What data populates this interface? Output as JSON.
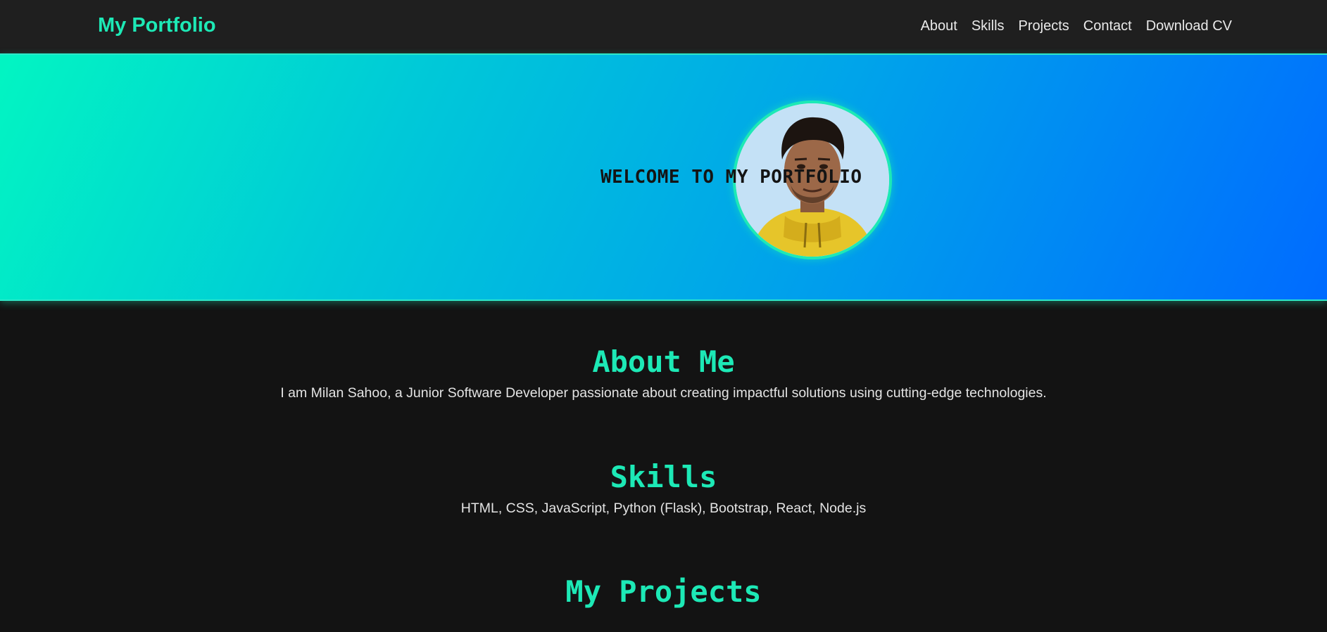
{
  "navbar": {
    "brand": "My Portfolio",
    "links": [
      {
        "label": "About"
      },
      {
        "label": "Skills"
      },
      {
        "label": "Projects"
      },
      {
        "label": "Contact"
      },
      {
        "label": "Download CV"
      }
    ]
  },
  "hero": {
    "title": "WELCOME TO MY PORTFOLIO",
    "image_alt": "profile-photo"
  },
  "about": {
    "heading": "About Me",
    "text": "I am Milan Sahoo, a Junior Software Developer passionate about creating impactful solutions using cutting-edge technologies."
  },
  "skills": {
    "heading": "Skills",
    "text": "HTML, CSS, JavaScript, Python (Flask), Bootstrap, React, Node.js"
  },
  "projects": {
    "heading": "My Projects"
  },
  "colors": {
    "accent": "#1de9b6",
    "navbar_bg": "#1f1f1f",
    "page_bg": "#131313",
    "hero_gradient_start": "#02f5c2",
    "hero_gradient_end": "#006bff"
  }
}
